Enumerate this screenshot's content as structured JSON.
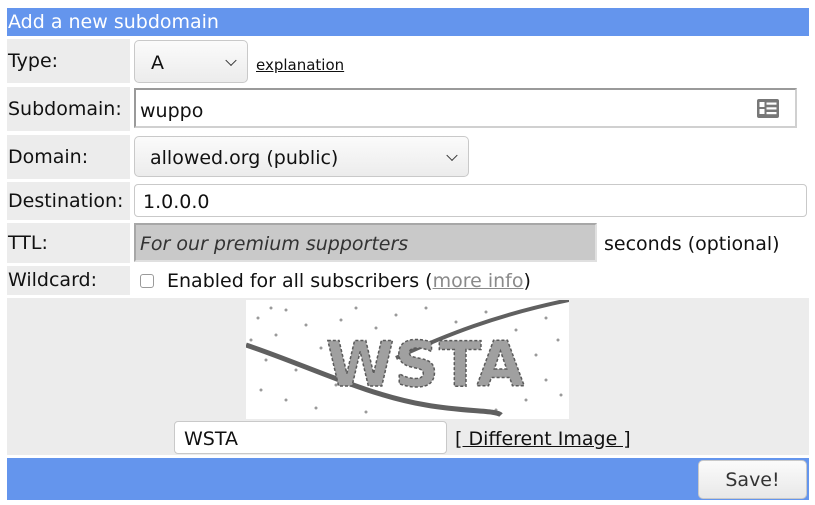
{
  "form": {
    "title": "Add a new subdomain",
    "type": {
      "label": "Type:",
      "value": "A",
      "explanation_link": "explanation"
    },
    "subdomain": {
      "label": "Subdomain:",
      "value": "wuppo"
    },
    "domain": {
      "label": "Domain:",
      "value": "allowed.org (public)"
    },
    "destination": {
      "label": "Destination:",
      "value": "1.0.0.0"
    },
    "ttl": {
      "label": "TTL:",
      "placeholder": "For our premium supporters",
      "suffix": "seconds (optional)"
    },
    "wildcard": {
      "label": "Wildcard:",
      "text_before": "Enabled for all subscribers (",
      "link": "more info",
      "text_after": ")",
      "checked": false
    },
    "captcha": {
      "image_text": "WSTA",
      "input_value": "WSTA",
      "different_image_link": "[ Different Image ]"
    },
    "save_label": "Save!"
  },
  "colors": {
    "header_bg": "#6495ed",
    "label_bg": "#ececec",
    "captcha_bg": "#ececec"
  }
}
